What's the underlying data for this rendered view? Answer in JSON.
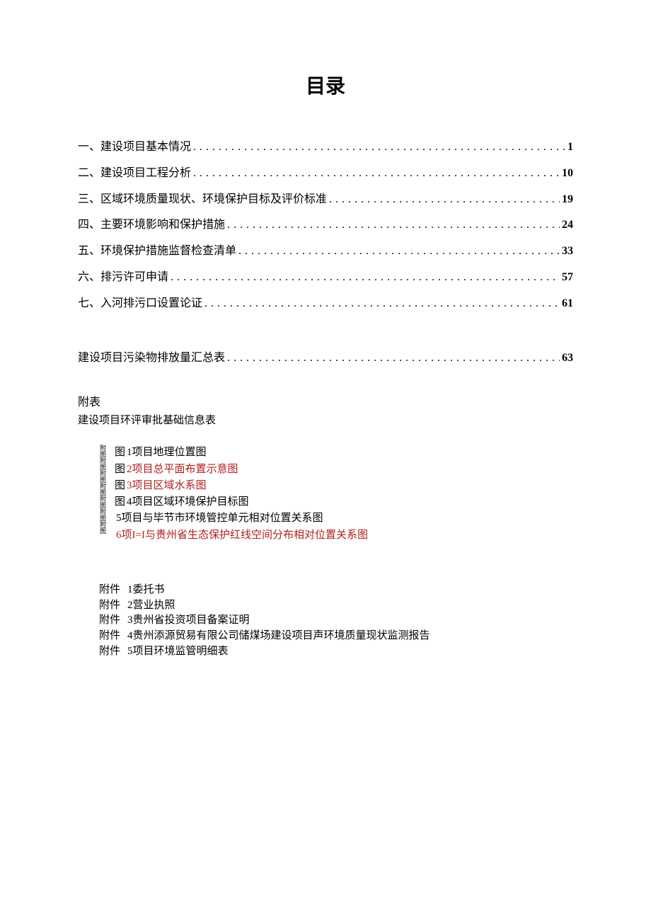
{
  "title": "目录",
  "toc": [
    {
      "label": "一、建设项目基本情况",
      "page": "1"
    },
    {
      "label": "二、建设项目工程分析",
      "page": "10"
    },
    {
      "label": "三、区域环境质量现状、环境保护目标及评价标准",
      "page": "19"
    },
    {
      "label": "四、主要环境影响和保护措施",
      "page": "24"
    },
    {
      "label": "五、环境保护措施监督检查清单",
      "page": "33"
    },
    {
      "label": "六、排污许可申请",
      "page": "57"
    },
    {
      "label": "七、入河排污口设置论证",
      "page": "61"
    }
  ],
  "summary": {
    "label": "建设项目污染物排放量汇总表",
    "page": "63"
  },
  "appendix": {
    "header": "附表",
    "sub": "建设项目环评审批基础信息表"
  },
  "figures_vertical": "附图附图附图附图附图附图附图",
  "figures": [
    {
      "prefix": "图",
      "num": "1",
      "text": "项目地理位置图",
      "red": false
    },
    {
      "prefix": "图",
      "num": "2",
      "text": "项目总平面布置示意图",
      "red": true
    },
    {
      "prefix": "图",
      "num": "3",
      "text": "项目区域水系图",
      "red": true
    },
    {
      "prefix": "图",
      "num": "4",
      "text": "项目区域环境保护目标图",
      "red": false
    },
    {
      "prefix": "",
      "num": "5",
      "text": "项目与毕节市环境管控单元相对位置关系图",
      "red": false
    },
    {
      "prefix": "",
      "num": "6",
      "text": "项I=I与贵州省生态保护红线空间分布相对位置关系图",
      "red": true
    }
  ],
  "attachments": [
    {
      "prefix": "附件",
      "num": "1",
      "text": "委托书"
    },
    {
      "prefix": "附件",
      "num": "2",
      "text": "营业执照"
    },
    {
      "prefix": "附件",
      "num": "3",
      "text": "贵州省投资项目备案证明"
    },
    {
      "prefix": "附件",
      "num": "4",
      "text": "贵州添源贸易有限公司储煤场建设项目声环境质量现状监测报告"
    },
    {
      "prefix": "附件",
      "num": "5",
      "text": "项目环境监管明细表"
    }
  ]
}
